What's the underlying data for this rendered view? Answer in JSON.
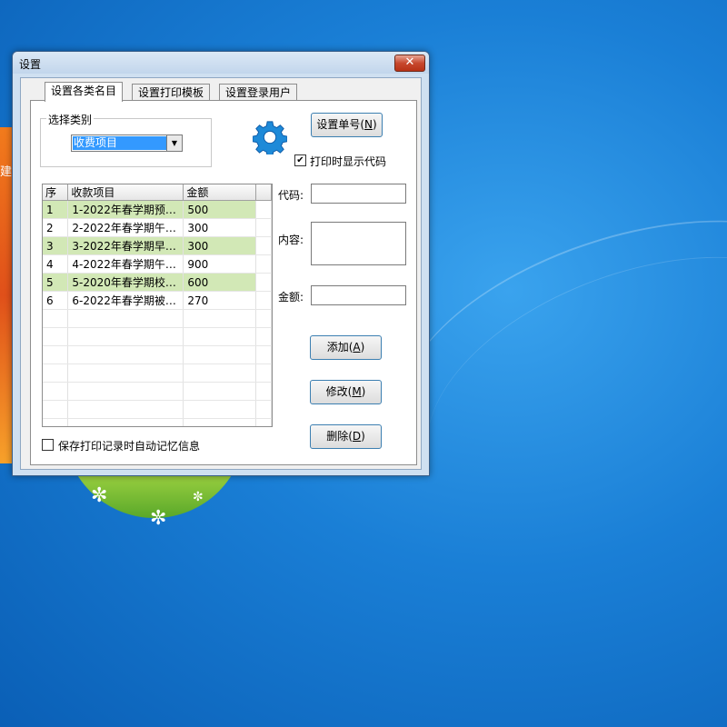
{
  "desktop": {
    "partial_icon_char": "建"
  },
  "window": {
    "title": "设置",
    "close_glyph": "✕"
  },
  "tabs": [
    {
      "label": "设置各类名目"
    },
    {
      "label": "设置打印模板"
    },
    {
      "label": "设置登录用户"
    }
  ],
  "category": {
    "group_label": "选择类别",
    "selected": "收费项目"
  },
  "icons": {
    "gear": "gear-icon",
    "dropdown": "chevron-down-icon"
  },
  "buttons": {
    "set_number": {
      "label": "设置单号(",
      "key": "N",
      "end": ")"
    },
    "add": {
      "label": "添加(",
      "key": "A",
      "end": ")"
    },
    "edit": {
      "label": "修改(",
      "key": "M",
      "end": ")"
    },
    "delete": {
      "label": "删除(",
      "key": "D",
      "end": ")"
    }
  },
  "options": {
    "show_code_on_print": {
      "label": "打印时显示代码",
      "checked": true
    },
    "auto_remember": {
      "label": "保存打印记录时自动记忆信息",
      "checked": false
    }
  },
  "fields": {
    "code": {
      "label": "代码:",
      "value": ""
    },
    "content": {
      "label": "内容:",
      "value": ""
    },
    "amount": {
      "label": "金额:",
      "value": ""
    }
  },
  "table": {
    "headers": [
      "序",
      "收款项目",
      "金额"
    ],
    "rows": [
      {
        "seq": "1",
        "item": "1-2022年春学期预…",
        "amount": "500"
      },
      {
        "seq": "2",
        "item": "2-2022年春学期午…",
        "amount": "300"
      },
      {
        "seq": "3",
        "item": "3-2022年春学期早…",
        "amount": "300"
      },
      {
        "seq": "4",
        "item": "4-2022年春学期午…",
        "amount": "900"
      },
      {
        "seq": "5",
        "item": "5-2020年春学期校…",
        "amount": "600"
      },
      {
        "seq": "6",
        "item": "6-2022年春学期被…",
        "amount": "270"
      }
    ]
  },
  "colors": {
    "row_highlight": "#d2e8b6",
    "selection": "#3399ff",
    "desktop": "#1a7fd6"
  }
}
